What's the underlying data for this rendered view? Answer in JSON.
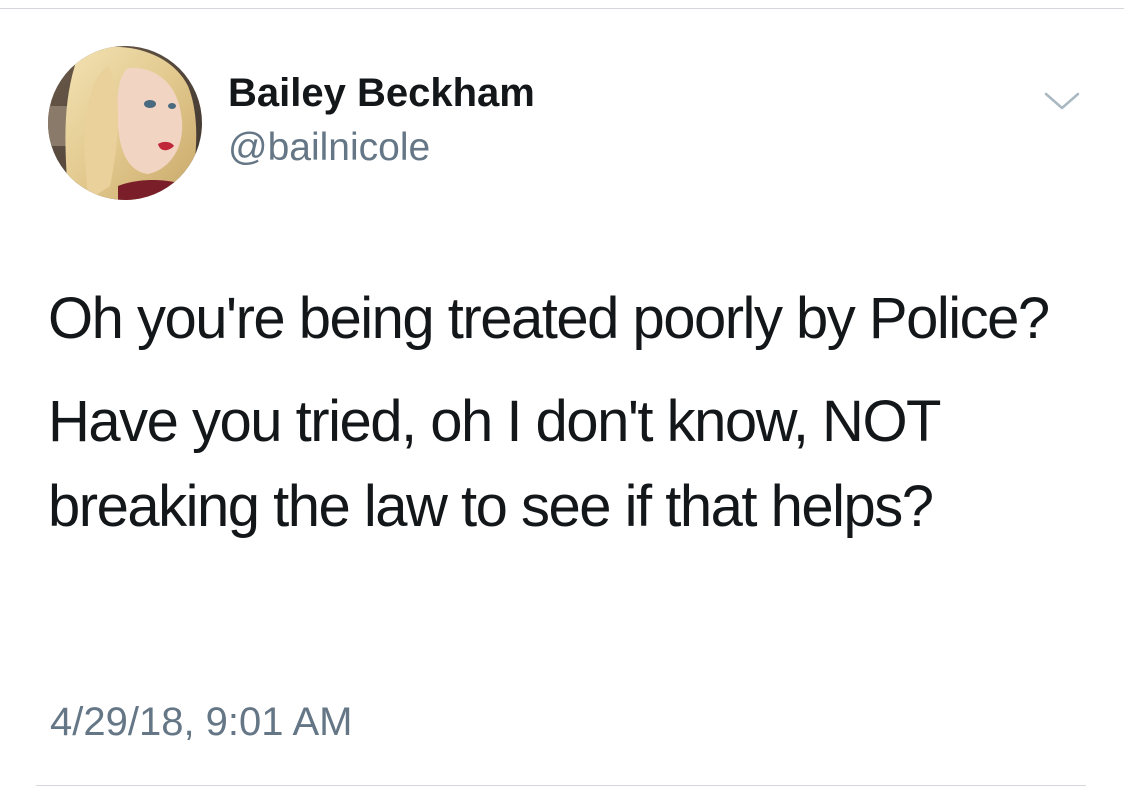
{
  "tweet": {
    "author": {
      "display_name": "Bailey Beckham",
      "handle": "@bailnicole"
    },
    "text_paragraphs": [
      "Oh you're being treated poorly by Police?",
      "Have you tried, oh I don't know, NOT breaking the law to see if that helps?"
    ],
    "timestamp": "4/29/18, 9:01 AM",
    "menu_icon": "chevron-down-icon"
  },
  "colors": {
    "text_primary": "#14171a",
    "text_secondary": "#657786",
    "divider": "#d4d8dc",
    "chevron": "#aab8c2"
  }
}
